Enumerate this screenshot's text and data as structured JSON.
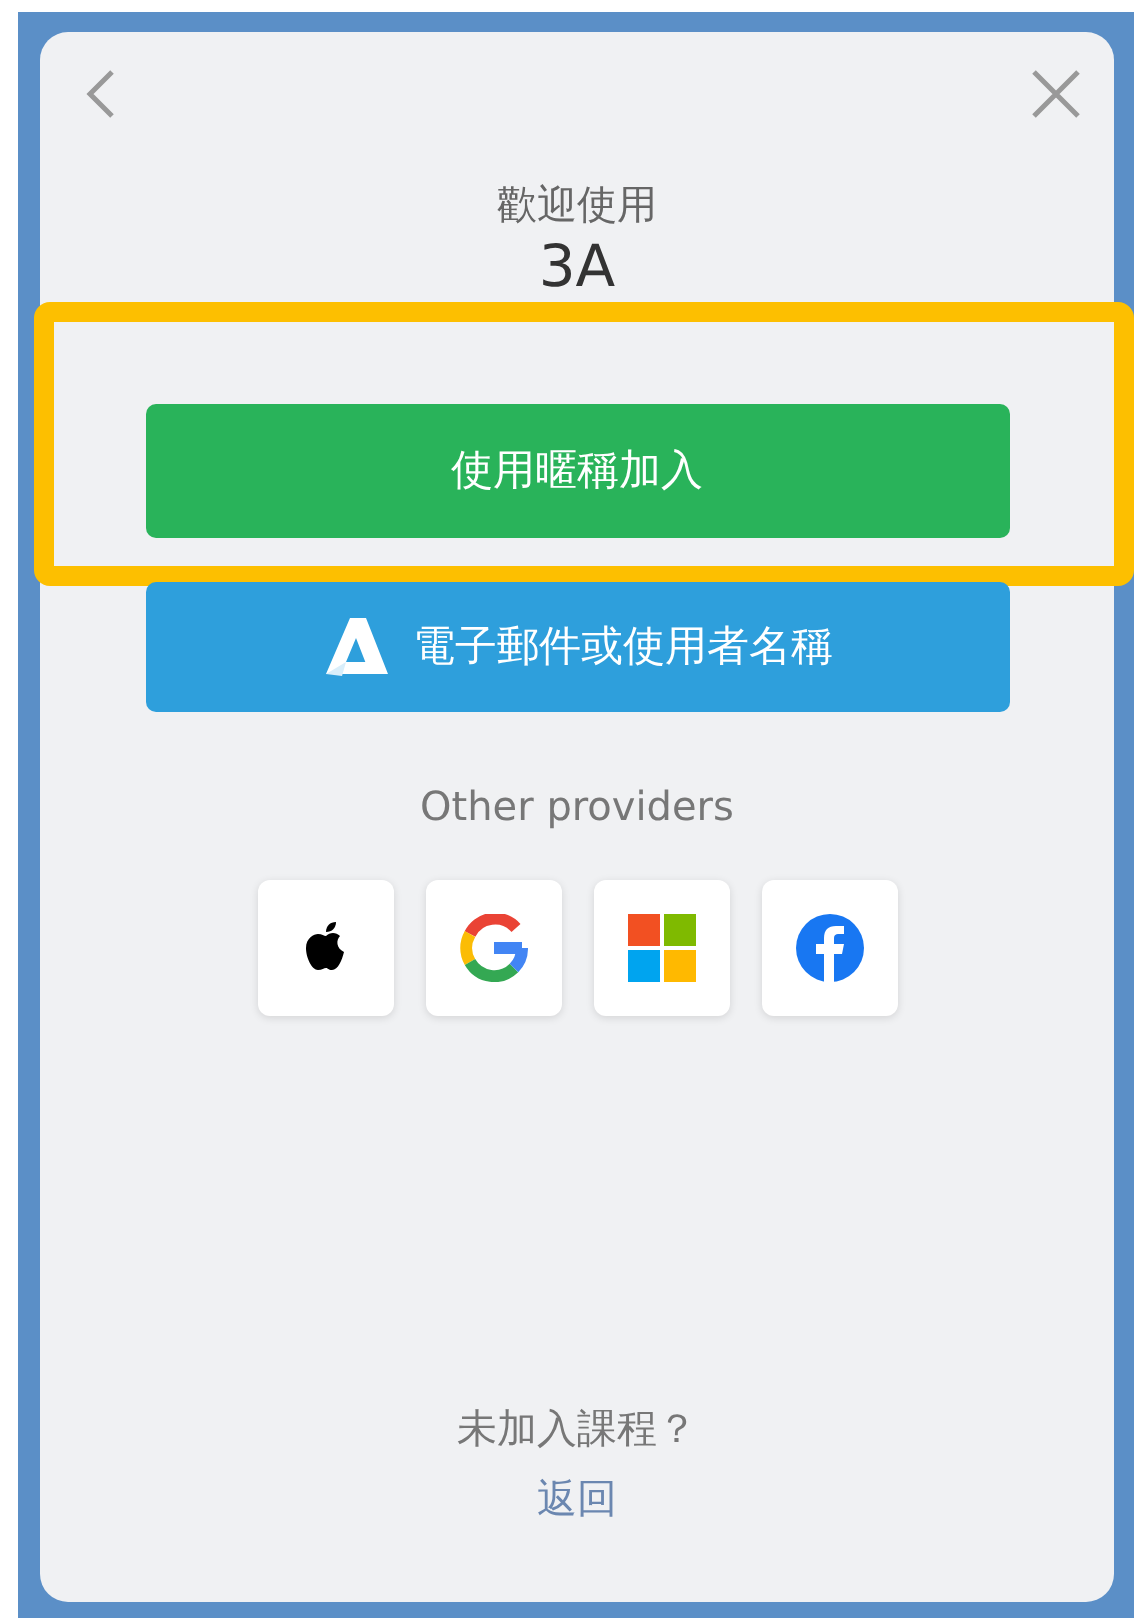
{
  "title": "歡迎使用",
  "class_name": "3A",
  "buttons": [
    {
      "label": "使用暱稱加入",
      "kind": "nickname",
      "highlighted": true
    },
    {
      "label": "電子郵件或使用者名稱",
      "kind": "account",
      "highlighted": false
    }
  ],
  "other_providers_label": "Other providers",
  "providers": [
    {
      "kind": "apple"
    },
    {
      "kind": "google"
    },
    {
      "kind": "microsoft"
    },
    {
      "kind": "facebook"
    }
  ],
  "footer": {
    "question": "未加入課程？",
    "link": "返回"
  }
}
